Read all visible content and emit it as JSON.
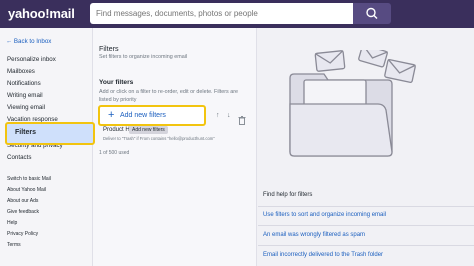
{
  "header": {
    "logo": "yahoo!mail",
    "search_placeholder": "Find messages, documents, photos or people"
  },
  "sidebar": {
    "back": "← Back to Inbox",
    "items": [
      "Personalize inbox",
      "Mailboxes",
      "Notifications",
      "Writing email",
      "Viewing email",
      "Vacation response",
      "Filters",
      "Security and privacy",
      "Contacts"
    ],
    "active_index": 6,
    "bottom_links": [
      "Switch to basic Mail",
      "About Yahoo Mail",
      "About our Ads",
      "Give feedback",
      "Help",
      "Privacy Policy",
      "Terms"
    ]
  },
  "filters_panel": {
    "title": "Filters",
    "subtitle": "Set filters to organize incoming email",
    "your_filters": "Your filters",
    "description": "Add or click on a filter to re-order, edit or delete. Filters are listed by priority",
    "add_button": "Add new filters",
    "filter_name": "Product H...",
    "tooltip": "Add new filters",
    "filter_meta": "Deliver to \"Trash\" if From contains \"hello@producthunt.com\"",
    "used": "1 of 500 used"
  },
  "help": {
    "title": "Find help for filters",
    "links": [
      "Use filters to sort and organize incoming email",
      "An email was wrongly filtered as spam",
      "Email incorrectly delivered to the Trash folder"
    ]
  },
  "colors": {
    "header": "#3a2f5c",
    "accent": "#1b5fbf",
    "highlight": "#f2c40f",
    "active_bg": "#cfe0fb"
  }
}
